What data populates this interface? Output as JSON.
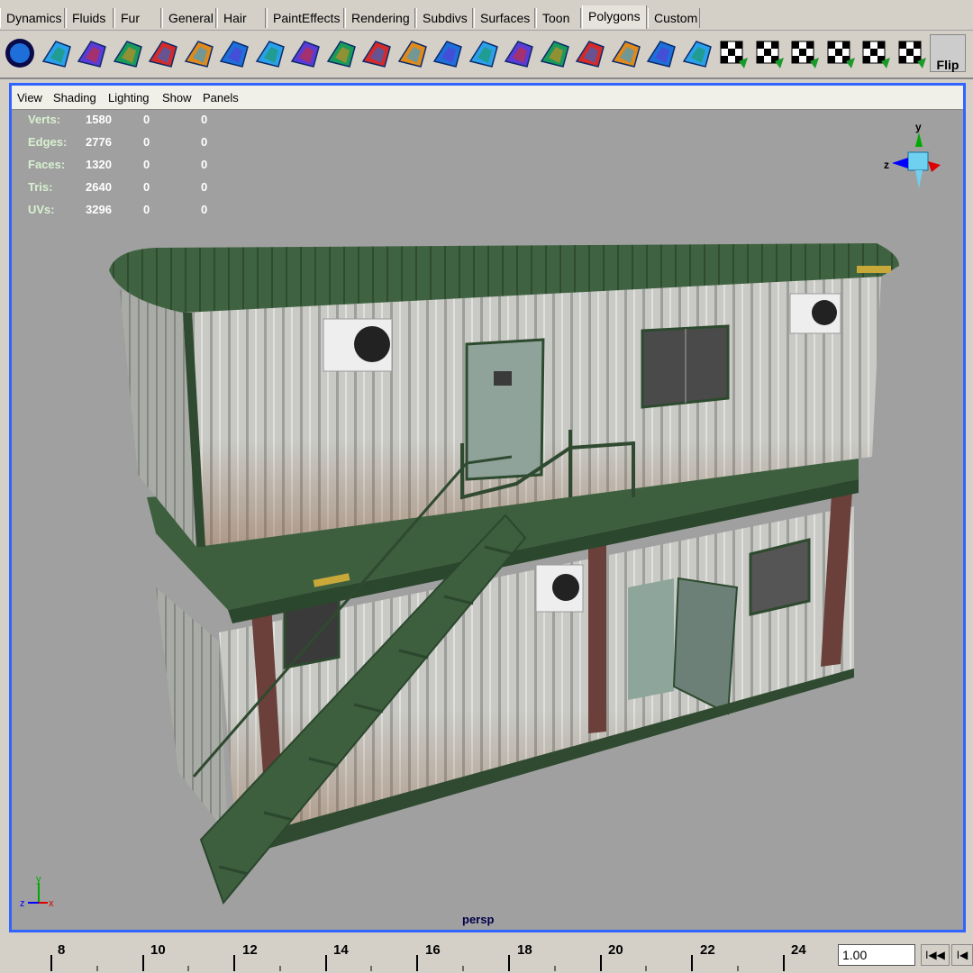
{
  "shelf_tabs": [
    {
      "label": "Dynamics"
    },
    {
      "label": "Fluids"
    },
    {
      "label": "Fur"
    },
    {
      "label": "General"
    },
    {
      "label": "Hair"
    },
    {
      "label": "PaintEffects"
    },
    {
      "label": "Rendering"
    },
    {
      "label": "Subdivs"
    },
    {
      "label": "Surfaces"
    },
    {
      "label": "Toon"
    },
    {
      "label": "Polygons",
      "active": true
    },
    {
      "label": "Custom"
    }
  ],
  "toolbar": {
    "icons": [
      "select-tool-icon",
      "merge-vertices-icon",
      "sphere-texture-icon",
      "cube-texture-icon",
      "wire-cube-icon",
      "extrude-face-icon",
      "split-face-icon",
      "bevel-icon",
      "extrude-edge-icon",
      "wedge-icon",
      "poke-icon",
      "chamfer-icon",
      "subdivide-icon",
      "append-icon",
      "map-uv-icon",
      "cut-uv-icon",
      "sew-uv-icon",
      "unfold-uv-icon",
      "layout-uv-icon",
      "pivot-icon",
      "map-checker-1-icon",
      "map-checker-2-icon",
      "map-checker-3-icon",
      "map-checker-4-icon",
      "map-checker-5-icon",
      "map-checker-6-icon"
    ],
    "flip_label": "Flip"
  },
  "viewport": {
    "menu": [
      "View",
      "Shading",
      "Lighting",
      "Show",
      "Panels"
    ],
    "hud": [
      {
        "label": "Verts:",
        "a": "1580",
        "b": "0",
        "c": "0"
      },
      {
        "label": "Edges:",
        "a": "2776",
        "b": "0",
        "c": "0"
      },
      {
        "label": "Faces:",
        "a": "1320",
        "b": "0",
        "c": "0"
      },
      {
        "label": "Tris:",
        "a": "2640",
        "b": "0",
        "c": "0"
      },
      {
        "label": "UVs:",
        "a": "3296",
        "b": "0",
        "c": "0"
      }
    ],
    "camera_label": "persp",
    "axes": {
      "x": "x",
      "y": "y",
      "z": "z"
    }
  },
  "timeline": {
    "ticks": [
      "8",
      "10",
      "12",
      "14",
      "16",
      "18",
      "20",
      "22",
      "24"
    ],
    "current_time": "1.00",
    "prev_key_label": "I◀◀",
    "prev_frame_label": "I◀"
  }
}
